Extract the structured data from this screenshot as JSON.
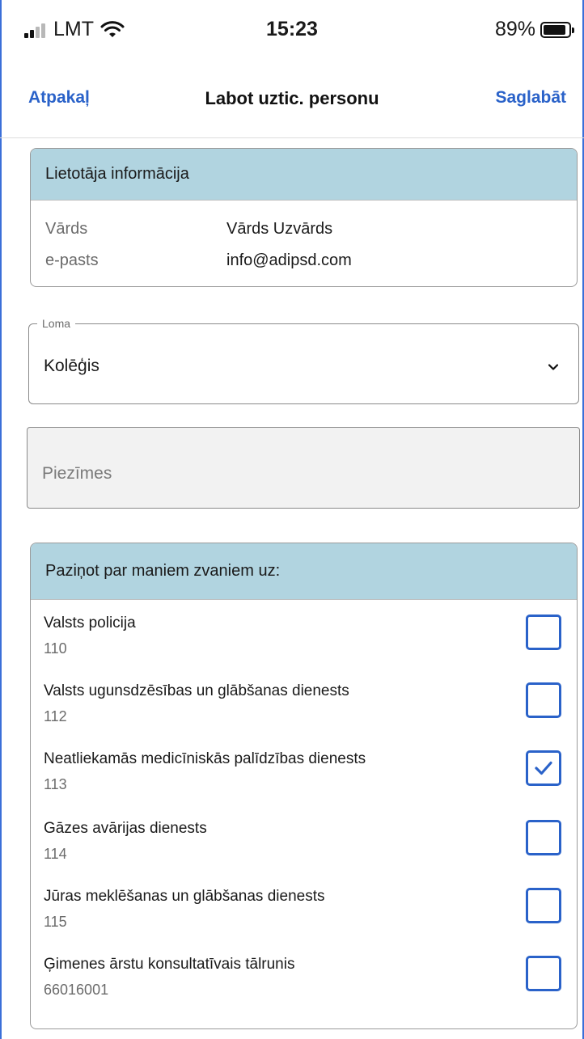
{
  "status_bar": {
    "carrier": "LMT",
    "time": "15:23",
    "battery_percent": "89%",
    "battery_level": 0.89
  },
  "nav": {
    "back_label": "Atpakaļ",
    "title": "Labot uztic. personu",
    "save_label": "Saglabāt"
  },
  "user_info": {
    "header": "Lietotāja informācija",
    "rows": [
      {
        "label": "Vārds",
        "value": "Vārds Uzvārds"
      },
      {
        "label": "e-pasts",
        "value": "info@adipsd.com"
      }
    ]
  },
  "role": {
    "legend": "Loma",
    "value": "Kolēģis"
  },
  "notes": {
    "placeholder": "Piezīmes"
  },
  "notify": {
    "header": "Paziņot par maniem zvaniem uz:",
    "services": [
      {
        "name": "Valsts policija",
        "number": "110",
        "checked": false
      },
      {
        "name": "Valsts ugunsdzēsības un glābšanas dienests",
        "number": "112",
        "checked": false
      },
      {
        "name": "Neatliekamās medicīniskās palīdzības dienests",
        "number": "113",
        "checked": true
      },
      {
        "name": "Gāzes avārijas dienests",
        "number": "114",
        "checked": false
      },
      {
        "name": "Jūras meklēšanas un glābšanas dienests",
        "number": "115",
        "checked": false
      },
      {
        "name": "Ģimenes ārstu konsultatīvais tālrunis",
        "number": "66016001",
        "checked": false
      }
    ]
  },
  "colors": {
    "accent": "#2a62c9",
    "section_header_bg": "#b1d4e0"
  }
}
